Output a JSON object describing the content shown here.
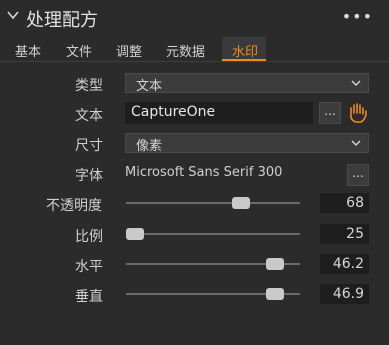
{
  "panel": {
    "title": "处理配方",
    "more_icon": "more-icon"
  },
  "tabs": [
    {
      "label": "基本",
      "active": false
    },
    {
      "label": "文件",
      "active": false
    },
    {
      "label": "调整",
      "active": false
    },
    {
      "label": "元数据",
      "active": false
    },
    {
      "label": "水印",
      "active": true
    }
  ],
  "watermark": {
    "type": {
      "label": "类型",
      "value": "文本"
    },
    "text": {
      "label": "文本",
      "value": "CaptureOne"
    },
    "size": {
      "label": "尺寸",
      "value": "像素"
    },
    "font": {
      "label": "字体",
      "value": "Microsoft Sans Serif 300"
    },
    "opacity": {
      "label": "不透明度",
      "value": "68",
      "fraction": 0.68
    },
    "scale": {
      "label": "比例",
      "value": "25",
      "fraction": 0.0
    },
    "horizontal": {
      "label": "水平",
      "value": "46.2",
      "fraction": 0.9
    },
    "vertical": {
      "label": "垂直",
      "value": "46.9",
      "fraction": 0.9
    }
  },
  "colors": {
    "accent": "#f28a1c",
    "background": "#2b2b2b"
  }
}
